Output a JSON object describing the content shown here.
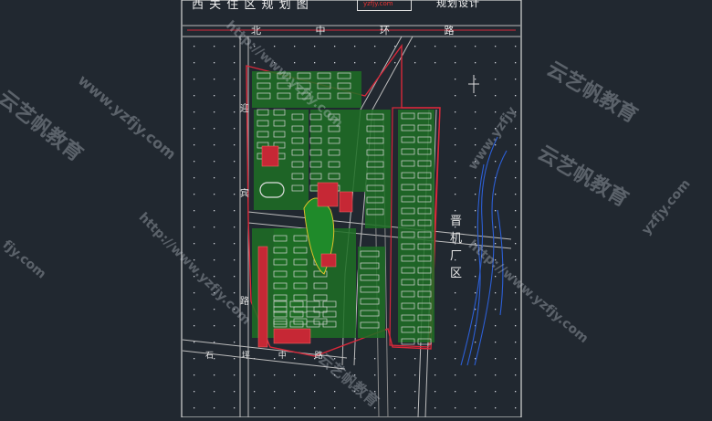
{
  "canvas": {
    "background": "#212830"
  },
  "title": {
    "main": "西 关 住 区 规 划 图",
    "tag": "yzfjy.com",
    "right": "规划设计"
  },
  "roads": {
    "north": "北 中 环 路",
    "west_chars": [
      "迎",
      "宾",
      "路"
    ],
    "southwest": "石 坪 中 路",
    "west": "迎宾路"
  },
  "district": {
    "chars": [
      "晋",
      "机",
      "厂",
      "区"
    ]
  },
  "watermarks": [
    {
      "text": "云艺帆教育"
    },
    {
      "text": "www.yzfjy.com"
    },
    {
      "text": "http://www.yzfjy.com"
    },
    {
      "text": "云艺帆教育"
    },
    {
      "text": "http://www.yzfjy.com"
    },
    {
      "text": "云艺帆教育"
    },
    {
      "text": "fjy.com"
    },
    {
      "text": "www.yzfjy"
    },
    {
      "text": "http://www.yzfjy.com"
    },
    {
      "text": "云艺帆教育"
    },
    {
      "text": "yzfjy.com"
    }
  ],
  "colors": {
    "boundary": "#d8283a",
    "green": "#2e9e33",
    "building": "#d8d8d8",
    "road": "#b8b8b8",
    "water": "#2c5fd6",
    "grid": "#cfd3da"
  }
}
